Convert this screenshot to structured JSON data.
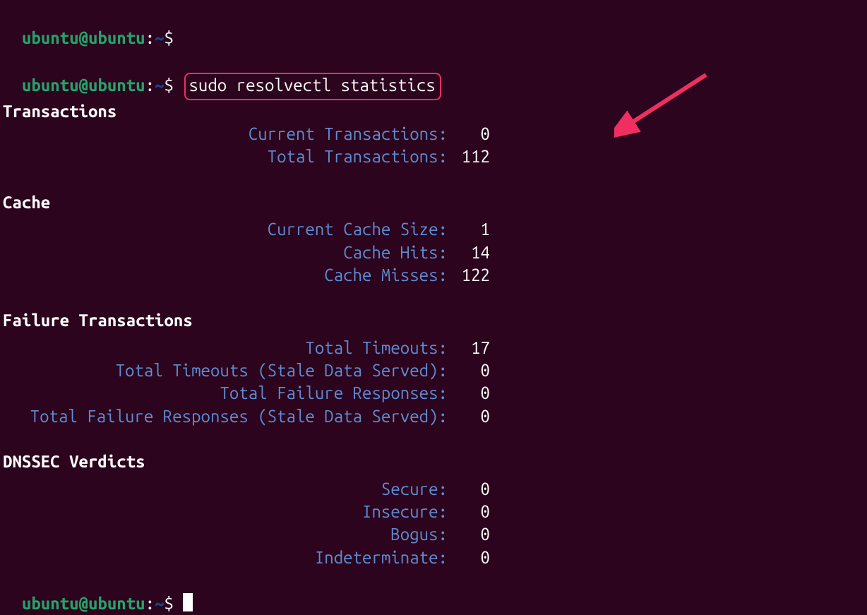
{
  "prompt": {
    "user": "ubuntu@ubuntu",
    "sep": ":",
    "tilde": "~",
    "dollar": "$"
  },
  "command": "sudo resolvectl statistics",
  "sections": {
    "transactions": {
      "title": "Transactions",
      "rows": [
        {
          "label": "Current Transactions:",
          "value": "0"
        },
        {
          "label": "Total Transactions:",
          "value": "112"
        }
      ]
    },
    "cache": {
      "title": "Cache",
      "rows": [
        {
          "label": "Current Cache Size:",
          "value": "1"
        },
        {
          "label": "Cache Hits:",
          "value": "14"
        },
        {
          "label": "Cache Misses:",
          "value": "122"
        }
      ]
    },
    "failure": {
      "title": "Failure Transactions",
      "rows": [
        {
          "label": "Total Timeouts:",
          "value": "17"
        },
        {
          "label": "Total Timeouts (Stale Data Served):",
          "value": "0"
        },
        {
          "label": "Total Failure Responses:",
          "value": "0"
        },
        {
          "label": "Total Failure Responses (Stale Data Served):",
          "value": "0"
        }
      ]
    },
    "dnssec": {
      "title": "DNSSEC Verdicts",
      "rows": [
        {
          "label": "Secure:",
          "value": "0"
        },
        {
          "label": "Insecure:",
          "value": "0"
        },
        {
          "label": "Bogus:",
          "value": "0"
        },
        {
          "label": "Indeterminate:",
          "value": "0"
        }
      ]
    }
  }
}
